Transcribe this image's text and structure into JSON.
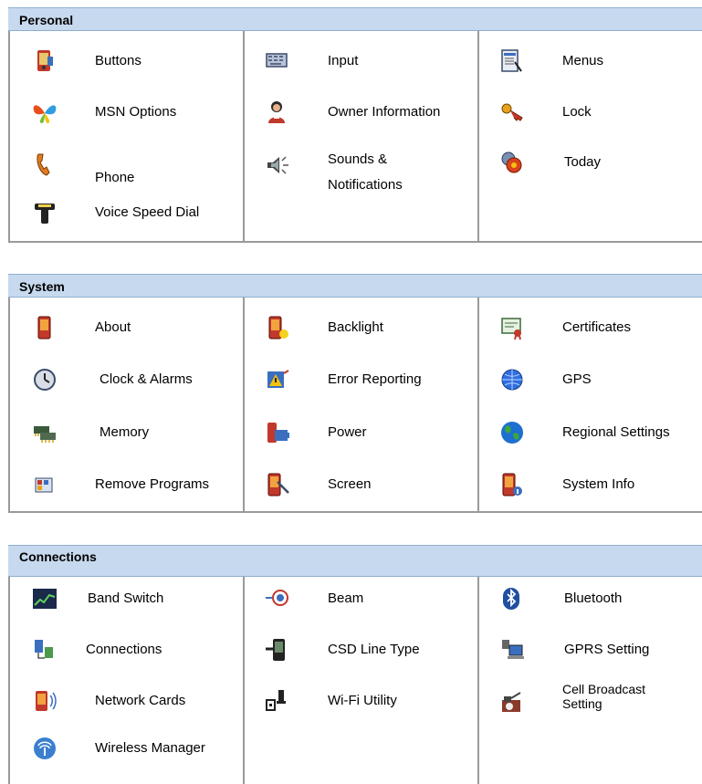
{
  "sections": [
    {
      "title": "Personal",
      "items": [
        {
          "label": "Buttons",
          "icon": "pda-buttons-icon"
        },
        {
          "label": "Input",
          "icon": "keyboard-input-icon"
        },
        {
          "label": "Menus",
          "icon": "menus-icon"
        },
        {
          "label": "MSN Options",
          "icon": "msn-butterfly-icon"
        },
        {
          "label": "Owner Information",
          "icon": "owner-icon"
        },
        {
          "label": "Lock",
          "icon": "lock-key-icon"
        },
        {
          "label": "Phone",
          "icon": "phone-icon"
        },
        {
          "label": "Sounds &",
          "label2": "Notifications",
          "icon": "speaker-icon"
        },
        {
          "label": "Today",
          "icon": "today-icon"
        },
        {
          "label": "Voice Speed Dial",
          "icon": "voice-dial-icon"
        }
      ]
    },
    {
      "title": "System",
      "items": [
        {
          "label": "About",
          "icon": "about-device-icon"
        },
        {
          "label": "Backlight",
          "icon": "backlight-icon"
        },
        {
          "label": "Certificates",
          "icon": "certificate-icon"
        },
        {
          "label": "Clock & Alarms",
          "icon": "clock-icon"
        },
        {
          "label": "Error Reporting",
          "icon": "error-report-icon"
        },
        {
          "label": "GPS",
          "icon": "gps-globe-icon"
        },
        {
          "label": "Memory",
          "icon": "memory-chip-icon"
        },
        {
          "label": "Power",
          "icon": "power-battery-icon"
        },
        {
          "label": "Regional Settings",
          "icon": "globe-icon"
        },
        {
          "label": "Remove Programs",
          "icon": "remove-programs-icon"
        },
        {
          "label": "Screen",
          "icon": "screen-stylus-icon"
        },
        {
          "label": "System Info",
          "icon": "system-info-icon"
        }
      ]
    },
    {
      "title": "Connections",
      "items": [
        {
          "label": "Band Switch",
          "icon": "band-switch-icon"
        },
        {
          "label": "Beam",
          "icon": "beam-infrared-icon"
        },
        {
          "label": "Bluetooth",
          "icon": "bluetooth-icon"
        },
        {
          "label": "Connections",
          "icon": "connections-network-icon"
        },
        {
          "label": "CSD Line Type",
          "icon": "csd-line-icon"
        },
        {
          "label": "GPRS Setting",
          "icon": "gprs-computer-icon"
        },
        {
          "label": "Network Cards",
          "icon": "network-card-icon"
        },
        {
          "label": "Wi-Fi Utility",
          "icon": "wifi-utility-icon"
        },
        {
          "label": "Cell Broadcast",
          "label2": "Setting",
          "icon": "cell-broadcast-icon"
        },
        {
          "label": "Wireless Manager",
          "icon": "wireless-manager-icon"
        }
      ]
    }
  ]
}
